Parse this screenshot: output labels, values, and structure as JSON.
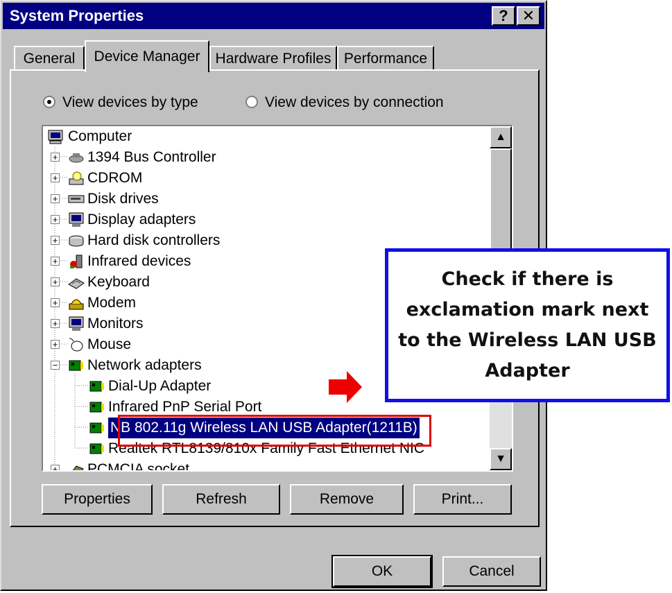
{
  "window": {
    "title": "System Properties",
    "help_glyph": "?",
    "close_glyph": "✕"
  },
  "tabs": [
    {
      "label": "General"
    },
    {
      "label": "Device Manager"
    },
    {
      "label": "Hardware Profiles"
    },
    {
      "label": "Performance"
    }
  ],
  "view_options": {
    "by_type": "View devices by type",
    "by_connection": "View devices by connection",
    "selected": "by_type"
  },
  "tree": {
    "root": "Computer",
    "items": [
      {
        "label": "1394 Bus Controller",
        "icon": "bus-icon"
      },
      {
        "label": "CDROM",
        "icon": "cdrom-icon"
      },
      {
        "label": "Disk drives",
        "icon": "disk-icon"
      },
      {
        "label": "Display adapters",
        "icon": "monitor-icon"
      },
      {
        "label": "Hard disk controllers",
        "icon": "controller-icon"
      },
      {
        "label": "Infrared devices",
        "icon": "infrared-icon"
      },
      {
        "label": "Keyboard",
        "icon": "keyboard-icon"
      },
      {
        "label": "Modem",
        "icon": "modem-icon"
      },
      {
        "label": "Monitors",
        "icon": "monitor-icon"
      },
      {
        "label": "Mouse",
        "icon": "mouse-icon"
      },
      {
        "label": "Network adapters",
        "icon": "network-icon",
        "expanded": true
      },
      {
        "label": "Dial-Up Adapter",
        "icon": "network-card-icon"
      },
      {
        "label": "Infrared PnP Serial Port",
        "icon": "network-card-icon"
      },
      {
        "label": "NB 802.11g Wireless LAN USB Adapter(1211B)",
        "icon": "network-card-icon",
        "selected": true
      },
      {
        "label": "Realtek RTL8139/810x Family Fast Ethernet NIC",
        "icon": "network-card-icon"
      },
      {
        "label": "PCMCIA socket",
        "icon": "pcmcia-icon"
      }
    ]
  },
  "buttons": {
    "properties": "Properties",
    "refresh": "Refresh",
    "remove": "Remove",
    "print": "Print...",
    "ok": "OK",
    "cancel": "Cancel"
  },
  "callout": {
    "text": "Check if there is exclamation mark next to the Wireless LAN USB Adapter"
  },
  "colors": {
    "titlebar": "#000080",
    "face": "#c0c0c0",
    "callout_border": "#1010e6",
    "highlight_border": "#e00000",
    "arrow": "#ee0000"
  }
}
